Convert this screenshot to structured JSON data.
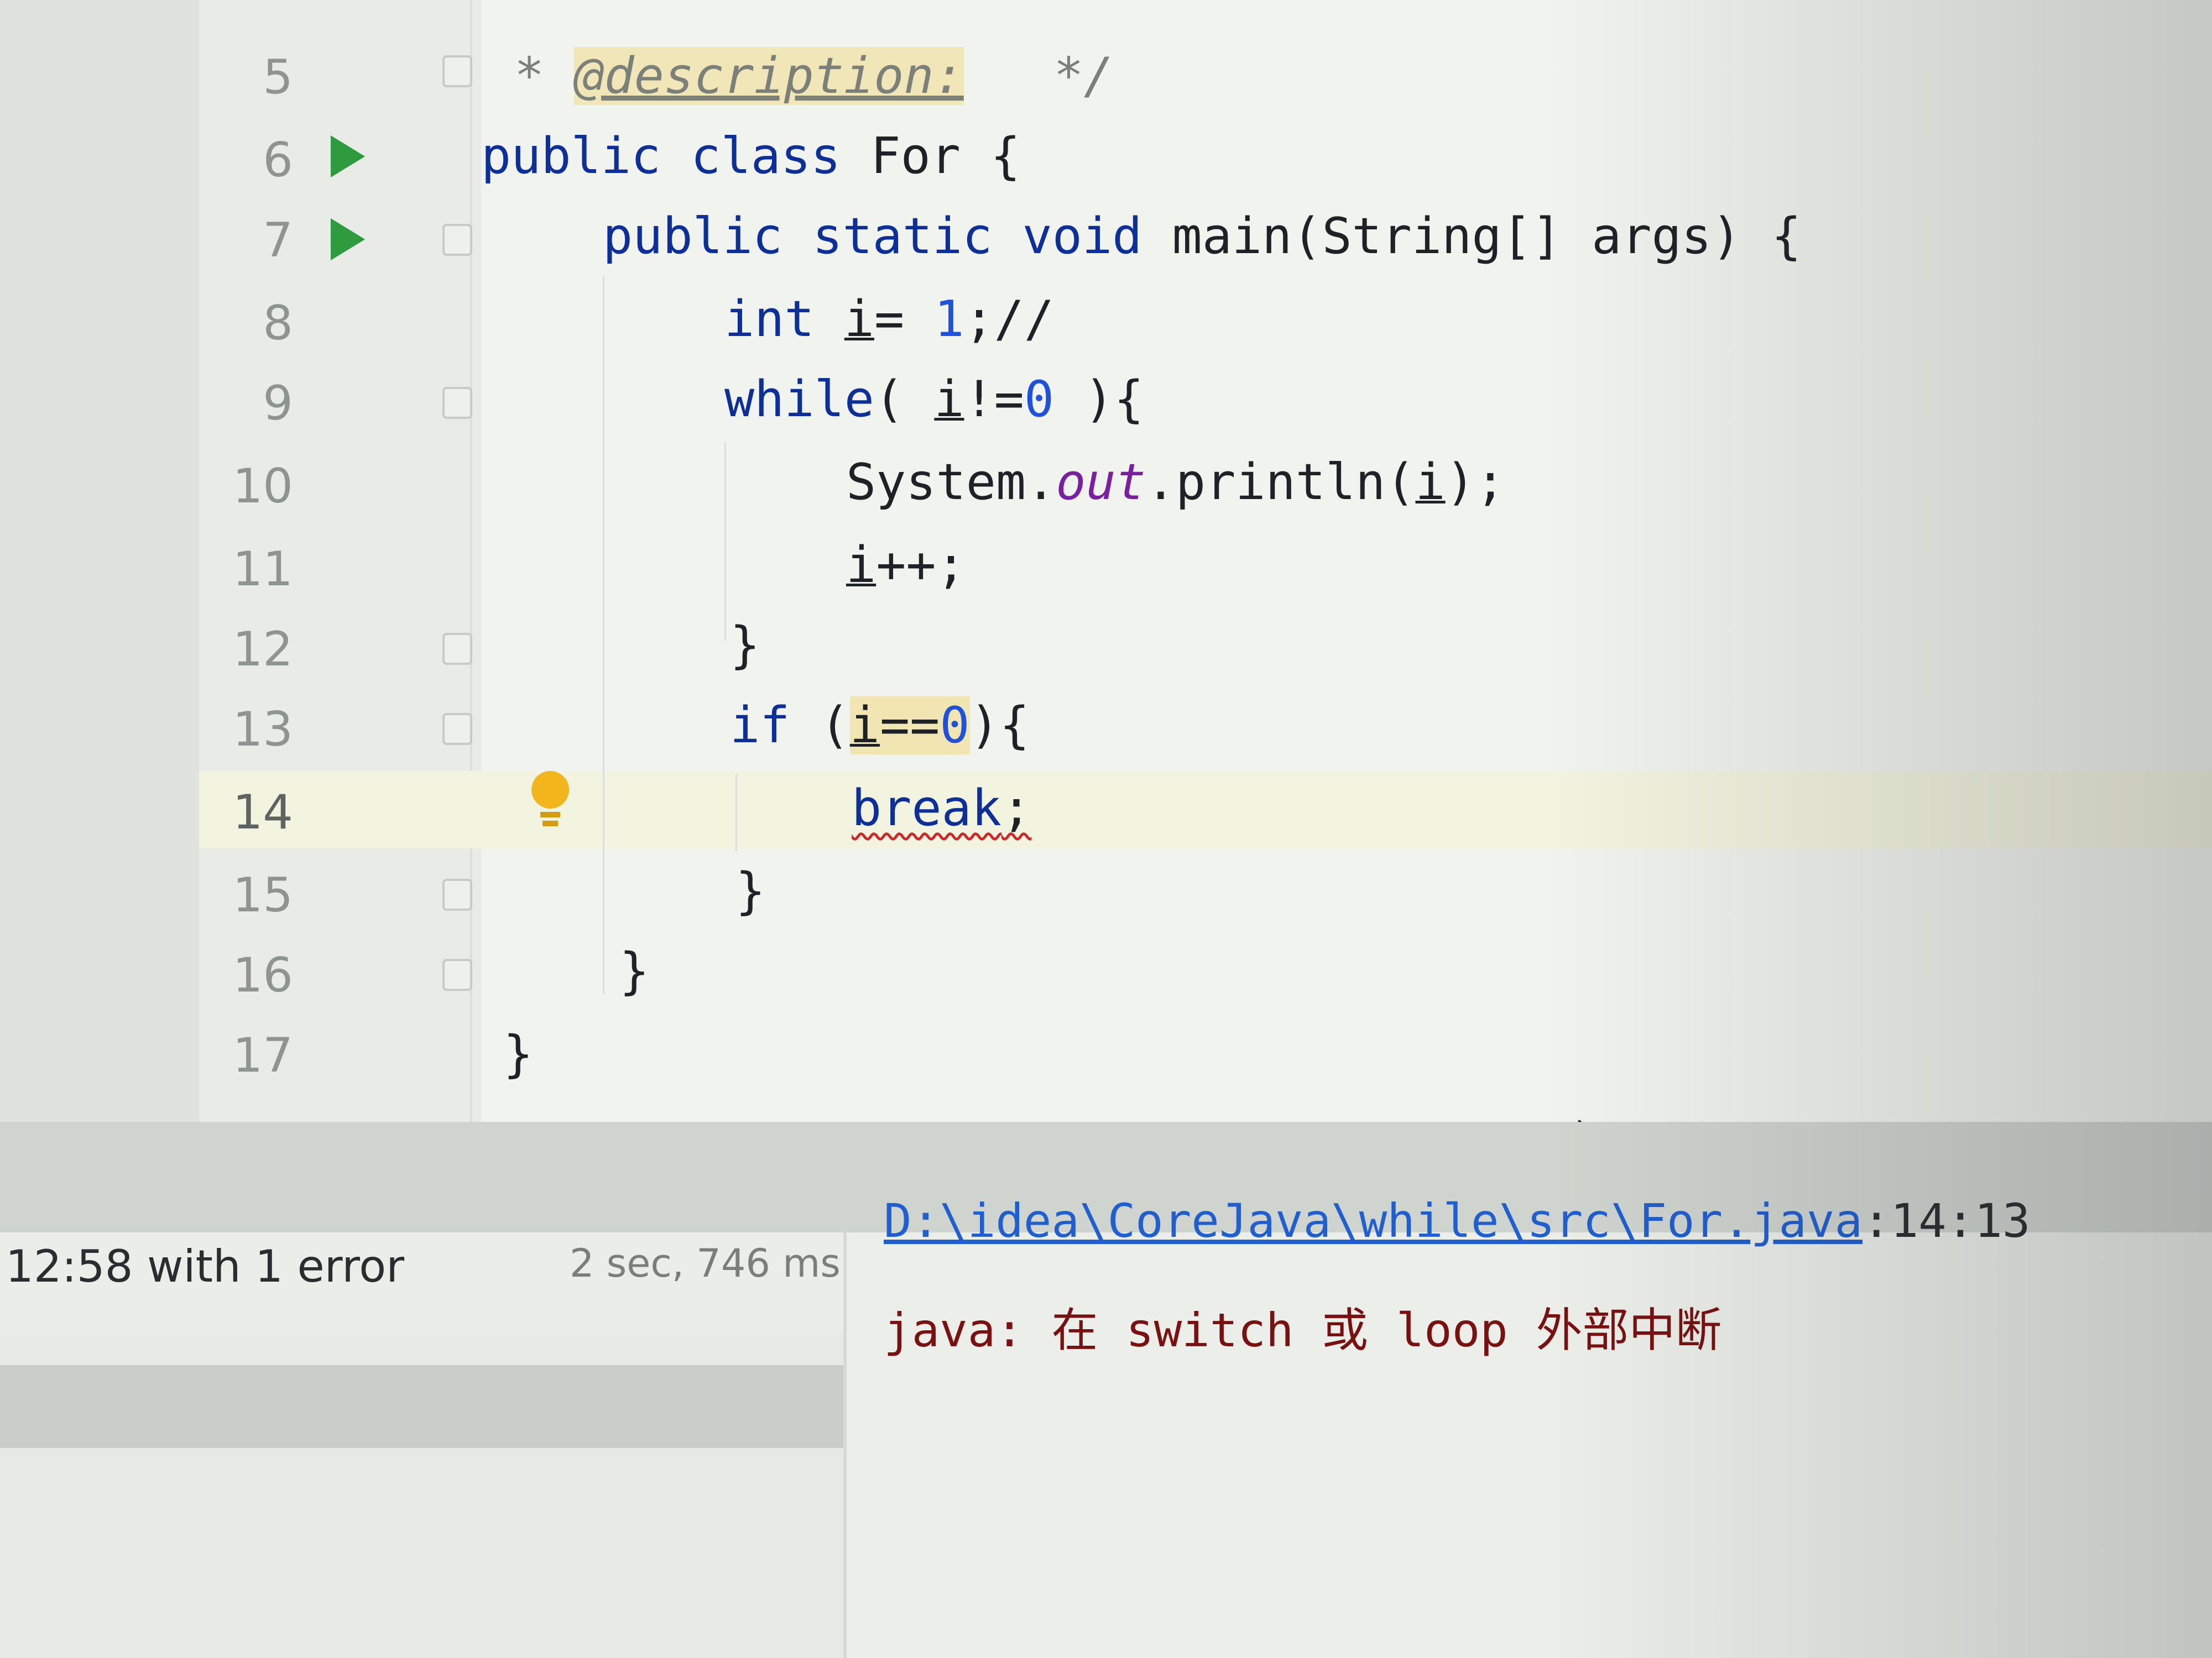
{
  "editor": {
    "line_numbers": [
      "5",
      "6",
      "7",
      "8",
      "9",
      "10",
      "11",
      "12",
      "13",
      "14",
      "15",
      "16",
      "17"
    ],
    "current_line": "14",
    "lines": {
      "l5": {
        "star": "* ",
        "tag": "@description:",
        "end": "   */"
      },
      "l6": {
        "kw": "public class ",
        "rest": "For {"
      },
      "l7": {
        "kw": "public static void ",
        "rest": "main(String[] args) {"
      },
      "l8": {
        "kw": "int ",
        "var": "i",
        "rest": "= ",
        "num": "1",
        "tail": ";//"
      },
      "l9": {
        "kw": "while",
        "open": "( ",
        "var": "i",
        "op": "!=",
        "num": "0",
        "tail": " ){"
      },
      "l10": {
        "obj": "System.",
        "field": "out",
        "call": ".println(",
        "var": "i",
        "tail": ");"
      },
      "l11": {
        "var": "i",
        "tail": "++;"
      },
      "l12": {
        "brace": "}"
      },
      "l13": {
        "kw": "if ",
        "open": "(",
        "var": "i",
        "op": "==",
        "num": "0",
        "tail": "){"
      },
      "l14": {
        "kw": "break",
        "tail": ";"
      },
      "l15": {
        "brace": "}"
      },
      "l16": {
        "brace": "}"
      },
      "l17": {
        "brace": "}"
      }
    },
    "colors": {
      "run_icon": "#2e9b3f",
      "bulb": "#f2b51c",
      "error_underline": "#d02828",
      "keyword": "#0d2f9a"
    }
  },
  "build": {
    "status": "12:58 with 1 error",
    "duration": "2 sec, 746 ms"
  },
  "messages": {
    "error_path": "D:\\idea\\CoreJava\\while\\src\\For.java",
    "error_position": ":14:13",
    "error_text": "java: 在 switch 或 loop 外部中断"
  }
}
